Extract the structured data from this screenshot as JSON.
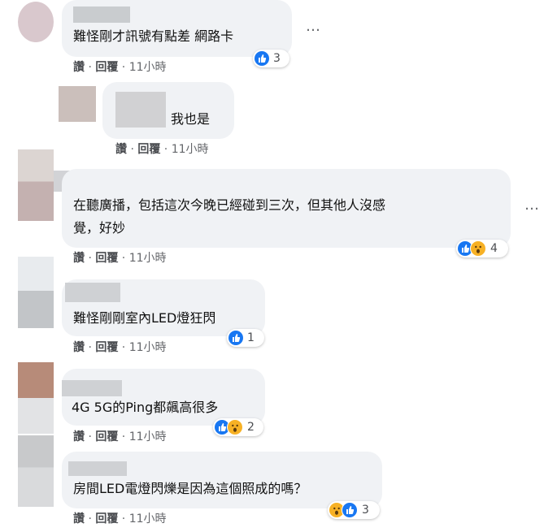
{
  "comments": [
    {
      "text": "難怪剛才訊號有點差 網路卡",
      "meta": {
        "like": "讚",
        "reply": "回覆",
        "time": "11小時"
      },
      "reactions": [
        "like"
      ],
      "count": "3",
      "more": "…"
    },
    {
      "text": "我也是",
      "meta": {
        "like": "讚",
        "reply": "回覆",
        "time": "11小時"
      }
    },
    {
      "text_lines": [
        "在聽廣播，包括這次今晚已經碰到三次，但其他人沒感",
        "覺，好妙"
      ],
      "meta": {
        "like": "讚",
        "reply": "回覆",
        "time": "11小時"
      },
      "reactions": [
        "like",
        "wow"
      ],
      "count": "4",
      "more": "…"
    },
    {
      "text": "難怪剛剛室內LED燈狂閃",
      "meta": {
        "like": "讚",
        "reply": "回覆",
        "time": "11小時"
      },
      "reactions": [
        "like"
      ],
      "count": "1"
    },
    {
      "text": "4G 5G的Ping都飆高很多",
      "meta": {
        "like": "讚",
        "reply": "回覆",
        "time": "11小時"
      },
      "reactions": [
        "like",
        "wow"
      ],
      "count": "2"
    },
    {
      "text": "房間LED電燈閃爍是因為這個照成的嗎？",
      "meta": {
        "like": "讚",
        "reply": "回覆",
        "time": "11小時"
      },
      "reactions": [
        "wow",
        "like"
      ],
      "count": "3"
    }
  ],
  "colors": {
    "bubble": "#f0f2f5",
    "like": "#1877f2",
    "wow": "#f7b125",
    "meta": "#65676b"
  }
}
